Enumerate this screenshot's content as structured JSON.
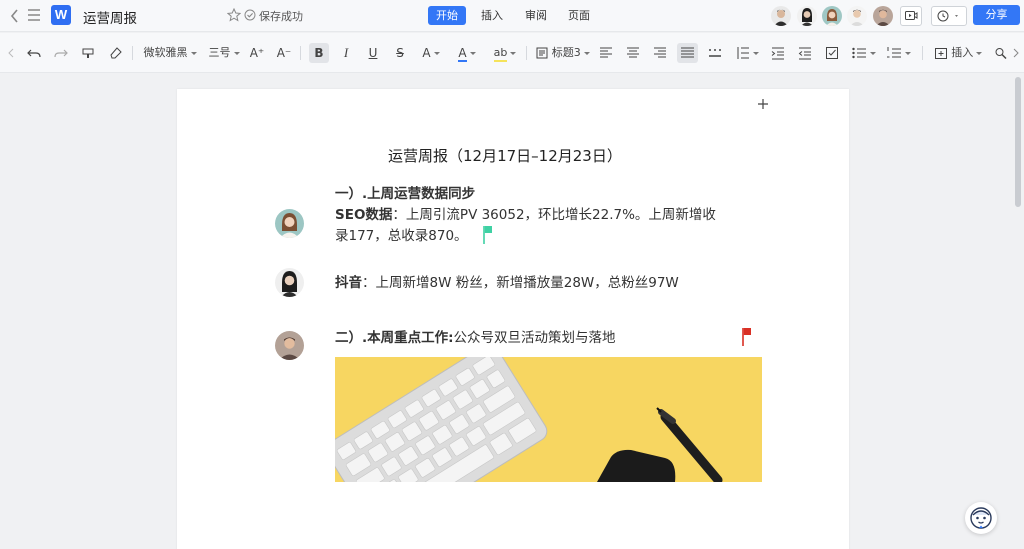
{
  "titlebar": {
    "logo_letter": "W",
    "doc_title": "运营周报",
    "save_status": "保存成功",
    "tabs": [
      {
        "label": "开始",
        "active": true
      },
      {
        "label": "插入",
        "active": false
      },
      {
        "label": "审阅",
        "active": false
      },
      {
        "label": "页面",
        "active": false
      }
    ],
    "share_label": "分享",
    "accent_color": "#3377f6"
  },
  "toolbar": {
    "font_family": "微软雅黑",
    "font_size": "三号",
    "heading_style": "标题3",
    "insert_label": "插入",
    "bold": "B",
    "italic": "I",
    "underline": "U",
    "strike": "S",
    "font_color_letter": "A",
    "grow_font": "A⁺",
    "shrink_font": "A⁻",
    "script_letter": "A",
    "highlight_letters": "ab"
  },
  "document": {
    "title": "运营周报（12月17日–12月23日）",
    "section1_heading": "一）.上周运营数据同步",
    "seo_label": "SEO数据",
    "seo_line1": "：上周引流PV 36052，环比增长22.7%。上周新增收",
    "seo_line2": "录177，总收录870。",
    "douyin_label": "抖音",
    "douyin_text": "：上周新增8W 粉丝，新增播放量28W，总粉丝97W",
    "section2_heading": "二）.本周重点工作:",
    "section2_text": "公众号双旦活动策划与落地",
    "flag_colors": {
      "green": "#3fd1a4",
      "red": "#d93025"
    },
    "image_background": "#f7d661"
  }
}
